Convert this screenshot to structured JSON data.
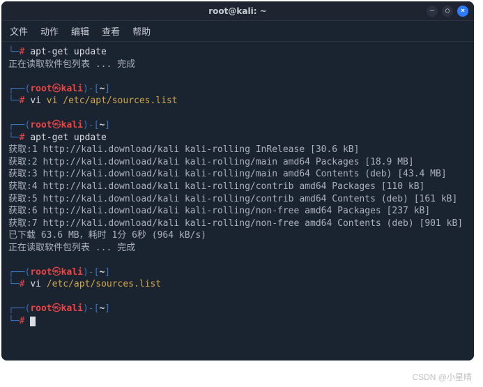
{
  "title": "root@kali: ~",
  "menu": {
    "file": "文件",
    "actions": "动作",
    "edit": "编辑",
    "view": "查看",
    "help": "帮助"
  },
  "window_controls": {
    "minimize": "–",
    "maximize": "○",
    "close": "×"
  },
  "prompt": {
    "dash": "#",
    "lparen": "┌──(",
    "user": "root",
    "at": "㉿",
    "host": "kali",
    "rparen_loc": ")-[",
    "path": "~",
    "close": "]",
    "bottom": "└─"
  },
  "cmd": {
    "apt_update": "apt-get update",
    "vi_sources": "vi /etc/apt/sources.list"
  },
  "output": {
    "partial_top_dash": "#",
    "partial_top_space": " ",
    "reading_done": "正在读取软件包列表 ... 完成",
    "lines": [
      "获取:1 http://kali.download/kali kali-rolling InRelease [30.6 kB]",
      "获取:2 http://kali.download/kali kali-rolling/main amd64 Packages [18.9 MB]",
      "获取:3 http://kali.download/kali kali-rolling/main amd64 Contents (deb) [43.4 MB]",
      "获取:4 http://kali.download/kali kali-rolling/contrib amd64 Packages [110 kB]",
      "获取:5 http://kali.download/kali kali-rolling/contrib amd64 Contents (deb) [161 kB]",
      "获取:6 http://kali.download/kali kali-rolling/non-free amd64 Packages [237 kB]",
      "获取:7 http://kali.download/kali kali-rolling/non-free amd64 Contents (deb) [901 kB]"
    ],
    "downloaded": "已下载 63.6 MB，耗时 1分 6秒 (964 kB/s)",
    "reading_done2": "正在读取软件包列表 ... 完成"
  },
  "watermark": "CSDN @小星晴"
}
